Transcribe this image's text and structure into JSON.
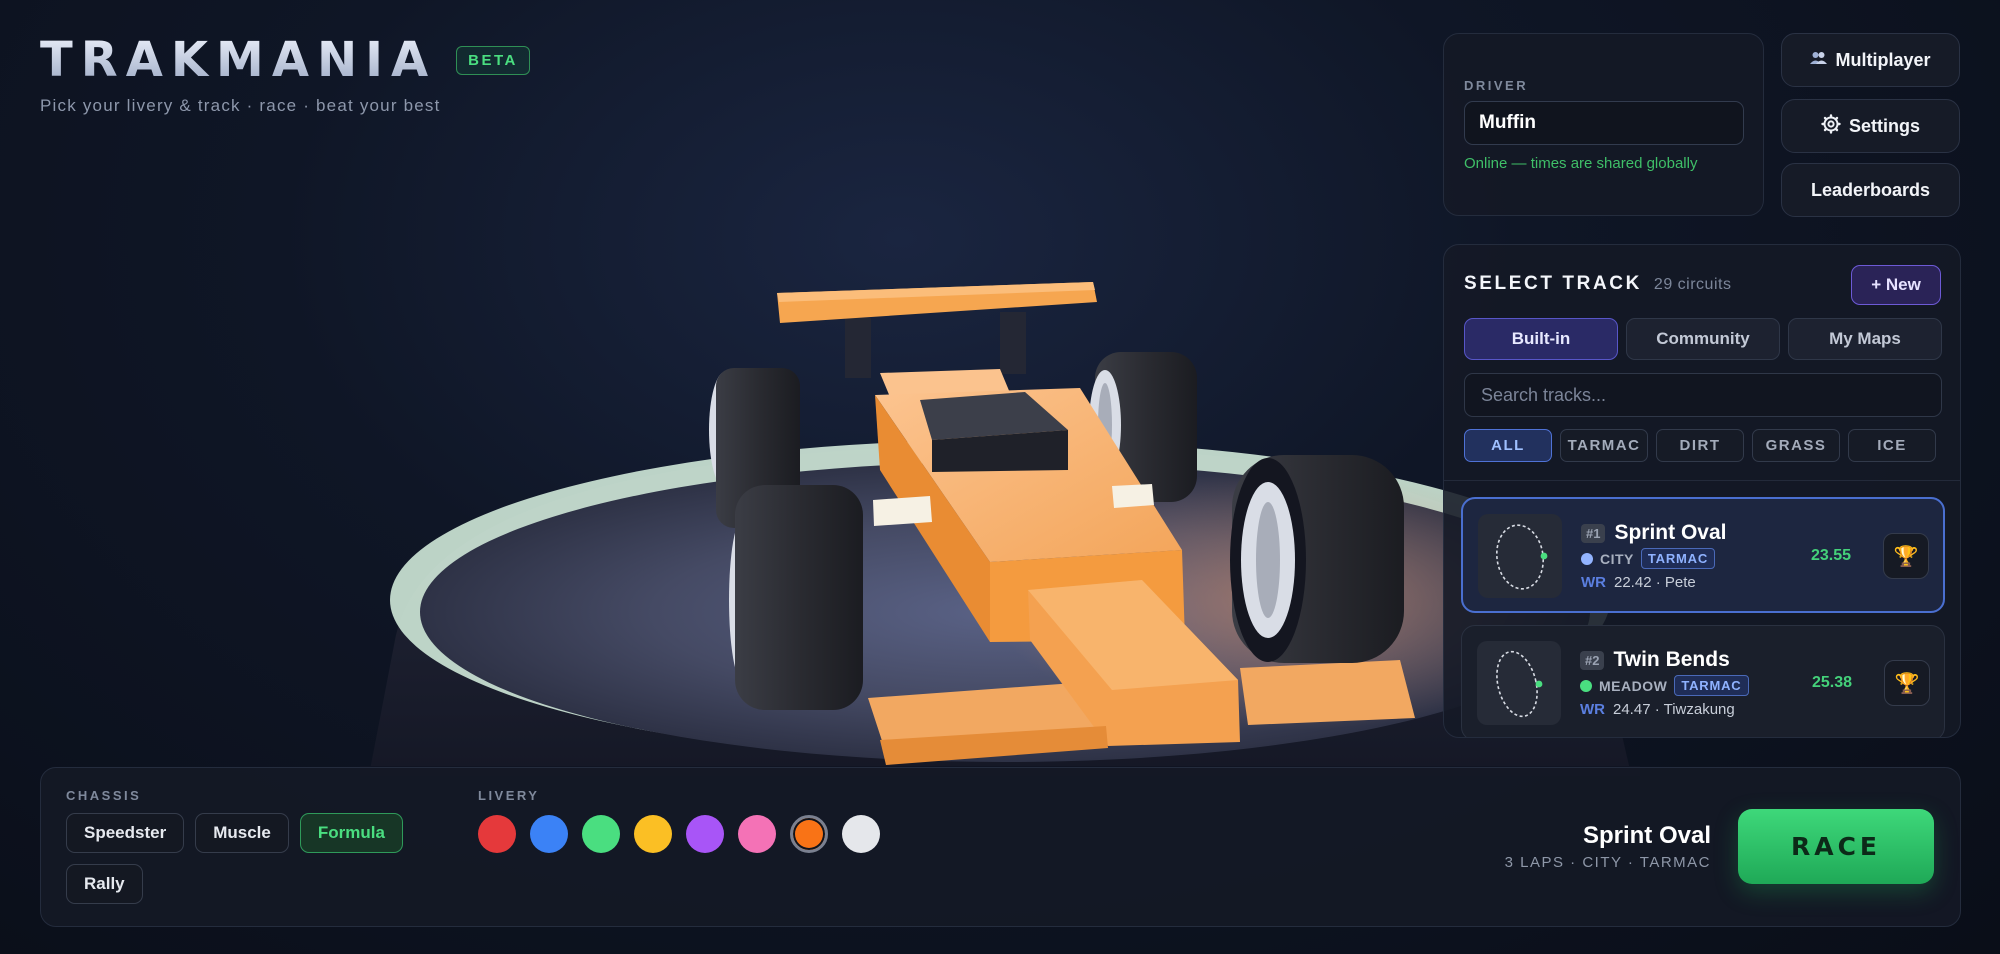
{
  "brand": {
    "title": "TRAKMANIA",
    "badge": "BETA",
    "tagline": "Pick your livery & track · race · beat your best"
  },
  "driver": {
    "label": "DRIVER",
    "name": "Muffin",
    "status": "Online — times are shared globally"
  },
  "side_buttons": {
    "multiplayer": {
      "icon": "people-icon",
      "label": "Multiplayer"
    },
    "settings": {
      "icon": "gear-icon",
      "label": "Settings"
    },
    "leaderboards": {
      "label": "Leaderboards"
    }
  },
  "tracks": {
    "title": "SELECT TRACK",
    "count": "29 circuits",
    "new_label": "+ New",
    "tabs": [
      "Built-in",
      "Community",
      "My Maps"
    ],
    "active_tab": "Built-in",
    "search_placeholder": "Search tracks...",
    "filters": [
      "ALL",
      "TARMAC",
      "DIRT",
      "GRASS",
      "ICE"
    ],
    "active_filter": "ALL",
    "list": [
      {
        "rank": "#1",
        "name": "Sprint Oval",
        "theme": "CITY",
        "theme_color": "#93b4ff",
        "surface": "TARMAC",
        "wr_label": "WR",
        "wr": "22.42 · Pete",
        "best": "23.55",
        "selected": true
      },
      {
        "rank": "#2",
        "name": "Twin Bends",
        "theme": "MEADOW",
        "theme_color": "#4ade80",
        "surface": "TARMAC",
        "wr_label": "WR",
        "wr": "24.47 · Tiwzakung",
        "best": "25.38",
        "selected": false
      }
    ]
  },
  "chassis": {
    "label": "CHASSIS",
    "options": [
      "Speedster",
      "Muscle",
      "Formula",
      "Rally"
    ],
    "selected": "Formula"
  },
  "livery": {
    "label": "LIVERY",
    "colors": [
      "#e5393b",
      "#3b82f6",
      "#4ade80",
      "#fbbf24",
      "#a855f7",
      "#f472b6",
      "#f97316",
      "#e5e7eb"
    ],
    "selected": "#f97316"
  },
  "summary": {
    "track": "Sprint Oval",
    "meta": "3 LAPS · CITY · TARMAC"
  },
  "race_label": "RACE"
}
